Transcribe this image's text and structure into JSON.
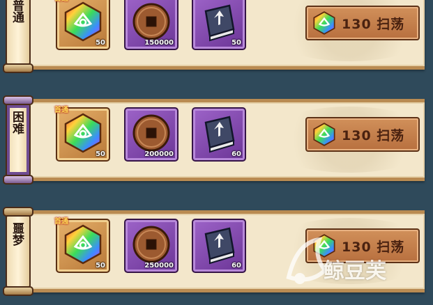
{
  "difficulties": [
    {
      "label": "普通",
      "tier": "wood",
      "first_clear_tag": "首通",
      "rewards": [
        {
          "name": "chakra-crystal-icon",
          "qty": "50",
          "frame": "gold"
        },
        {
          "name": "coin-icon",
          "qty": "150000",
          "frame": "purple"
        },
        {
          "name": "exp-book-icon",
          "qty": "50",
          "frame": "purple"
        }
      ],
      "sweep": {
        "cost_icon": "chakra-crystal-icon",
        "label": "130 扫荡"
      }
    },
    {
      "label": "困难",
      "tier": "purple",
      "first_clear_tag": "首通",
      "rewards": [
        {
          "name": "chakra-crystal-icon",
          "qty": "50",
          "frame": "gold"
        },
        {
          "name": "coin-icon",
          "qty": "200000",
          "frame": "purple"
        },
        {
          "name": "exp-book-icon",
          "qty": "60",
          "frame": "purple"
        }
      ],
      "sweep": {
        "cost_icon": "chakra-crystal-icon",
        "label": "130 扫荡"
      }
    },
    {
      "label": "噩梦",
      "tier": "wood",
      "first_clear_tag": "首通",
      "rewards": [
        {
          "name": "chakra-crystal-icon",
          "qty": "50",
          "frame": "gold"
        },
        {
          "name": "coin-icon",
          "qty": "250000",
          "frame": "purple"
        },
        {
          "name": "exp-book-icon",
          "qty": "60",
          "frame": "purple"
        }
      ],
      "sweep": {
        "cost_icon": "chakra-crystal-icon",
        "label": "130 扫荡"
      }
    }
  ],
  "watermark": {
    "text": "鲸豆芙"
  }
}
